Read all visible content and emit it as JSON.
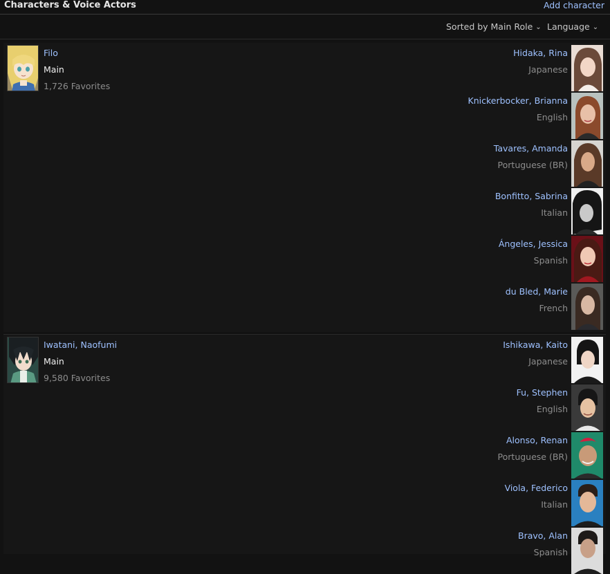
{
  "header": {
    "title": "Characters & Voice Actors",
    "add_label": "Add character"
  },
  "controls": {
    "sort_label": "Sorted by Main Role",
    "language_label": "Language"
  },
  "characters": [
    {
      "name": "Filo",
      "role": "Main",
      "favorites": "1,726 Favorites",
      "voice_actors": [
        {
          "name": "Hidaka, Rina",
          "language": "Japanese"
        },
        {
          "name": "Knickerbocker, Brianna",
          "language": "English"
        },
        {
          "name": "Tavares, Amanda",
          "language": "Portuguese (BR)"
        },
        {
          "name": "Bonfitto, Sabrina",
          "language": "Italian"
        },
        {
          "name": "Ángeles, Jessica",
          "language": "Spanish"
        },
        {
          "name": "du Bled, Marie",
          "language": "French"
        }
      ]
    },
    {
      "name": "Iwatani, Naofumi",
      "role": "Main",
      "favorites": "9,580 Favorites",
      "voice_actors": [
        {
          "name": "Ishikawa, Kaito",
          "language": "Japanese"
        },
        {
          "name": "Fu, Stephen",
          "language": "English"
        },
        {
          "name": "Alonso, Renan",
          "language": "Portuguese (BR)"
        },
        {
          "name": "Viola, Federico",
          "language": "Italian"
        },
        {
          "name": "Bravo, Alan",
          "language": "Spanish"
        }
      ]
    }
  ]
}
